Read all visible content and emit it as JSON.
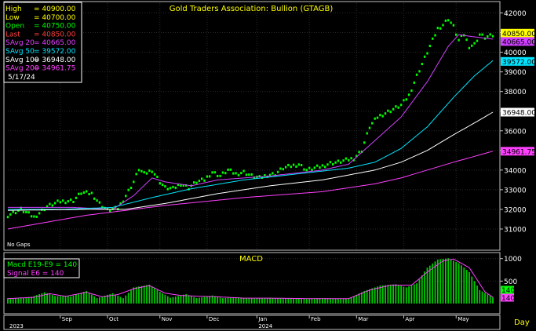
{
  "chart_data": [
    {
      "type": "scatter",
      "title": "Gold Traders Association: Bullion (GTAGB)",
      "ylim": [
        30000,
        42500
      ],
      "y_ticks": [
        31000,
        32000,
        33000,
        34000,
        35000,
        36000,
        37000,
        38000,
        39000,
        40000,
        41000,
        42000
      ],
      "footnote": "No Gaps",
      "info_box": {
        "rows": [
          {
            "label": "High",
            "value": "40900.00",
            "color": "#ffff00"
          },
          {
            "label": "Low",
            "value": "40700.00",
            "color": "#ffff00"
          },
          {
            "label": "Open",
            "value": "40750.00",
            "color": "#00ff00"
          },
          {
            "label": "Last",
            "value": "40850.00",
            "color": "#ff4040"
          },
          {
            "label": "SAvg  20",
            "value": "40665.00",
            "color": "#e040ff"
          },
          {
            "label": "SAvg  50",
            "value": "39572.00",
            "color": "#00e5ff"
          },
          {
            "label": "SAvg 100",
            "value": "36948.00",
            "color": "#ffffff"
          },
          {
            "label": "SAvg 200",
            "value": "34961.75",
            "color": "#ff40ff"
          }
        ],
        "date": "5/17/24"
      },
      "price_series": {
        "name": "Last",
        "color": "#00ff00",
        "anchors": [
          [
            0,
            31700
          ],
          [
            5,
            32000
          ],
          [
            10,
            31600
          ],
          [
            15,
            32150
          ],
          [
            20,
            32400
          ],
          [
            25,
            32450
          ],
          [
            28,
            32850
          ],
          [
            32,
            32800
          ],
          [
            35,
            32300
          ],
          [
            38,
            31950
          ],
          [
            42,
            32050
          ],
          [
            45,
            32700
          ],
          [
            48,
            33400
          ],
          [
            50,
            34050
          ],
          [
            52,
            33800
          ],
          [
            55,
            34000
          ],
          [
            58,
            33400
          ],
          [
            60,
            33100
          ],
          [
            63,
            33050
          ],
          [
            66,
            33300
          ],
          [
            69,
            33100
          ],
          [
            72,
            33400
          ],
          [
            75,
            33500
          ],
          [
            78,
            33900
          ],
          [
            81,
            33700
          ],
          [
            84,
            34000
          ],
          [
            87,
            33800
          ],
          [
            90,
            33900
          ],
          [
            93,
            33700
          ],
          [
            96,
            33600
          ],
          [
            99,
            33750
          ],
          [
            102,
            33800
          ],
          [
            105,
            34100
          ],
          [
            108,
            34200
          ],
          [
            111,
            34300
          ],
          [
            114,
            34000
          ],
          [
            117,
            34100
          ],
          [
            120,
            34200
          ],
          [
            123,
            34350
          ],
          [
            126,
            34400
          ],
          [
            129,
            34500
          ],
          [
            132,
            34600
          ],
          [
            135,
            35000
          ],
          [
            138,
            36200
          ],
          [
            141,
            36700
          ],
          [
            144,
            36900
          ],
          [
            147,
            37100
          ],
          [
            150,
            37300
          ],
          [
            153,
            37800
          ],
          [
            156,
            38800
          ],
          [
            159,
            39700
          ],
          [
            162,
            40600
          ],
          [
            164,
            41200
          ],
          [
            166,
            41400
          ],
          [
            168,
            41700
          ],
          [
            170,
            41300
          ],
          [
            172,
            40600
          ],
          [
            174,
            40900
          ],
          [
            176,
            40300
          ],
          [
            178,
            40400
          ],
          [
            180,
            40900
          ],
          [
            182,
            40750
          ],
          [
            185,
            40850
          ]
        ]
      },
      "averages": [
        {
          "name": "SAvg 20",
          "color": "#d040ff",
          "value": "40665.00",
          "anchors": [
            [
              0,
              32100
            ],
            [
              25,
              32100
            ],
            [
              40,
              32000
            ],
            [
              48,
              32700
            ],
            [
              55,
              33600
            ],
            [
              60,
              33400
            ],
            [
              70,
              33200
            ],
            [
              80,
              33500
            ],
            [
              100,
              33700
            ],
            [
              120,
              34000
            ],
            [
              130,
              34300
            ],
            [
              140,
              35500
            ],
            [
              150,
              36700
            ],
            [
              160,
              38500
            ],
            [
              168,
              40300
            ],
            [
              172,
              40900
            ],
            [
              177,
              40800
            ],
            [
              185,
              40665
            ]
          ]
        },
        {
          "name": "SAvg 50",
          "color": "#00e5ff",
          "value": "39572.00",
          "anchors": [
            [
              0,
              32000
            ],
            [
              20,
              32000
            ],
            [
              40,
              32100
            ],
            [
              55,
              32600
            ],
            [
              70,
              33050
            ],
            [
              90,
              33500
            ],
            [
              110,
              33800
            ],
            [
              130,
              34100
            ],
            [
              140,
              34400
            ],
            [
              150,
              35100
            ],
            [
              160,
              36200
            ],
            [
              170,
              37700
            ],
            [
              178,
              38800
            ],
            [
              185,
              39572
            ]
          ]
        },
        {
          "name": "SAvg 100",
          "color": "#ffffff",
          "value": "36948.00",
          "anchors": [
            [
              0,
              31950
            ],
            [
              30,
              32000
            ],
            [
              45,
              32000
            ],
            [
              60,
              32300
            ],
            [
              80,
              32800
            ],
            [
              100,
              33200
            ],
            [
              120,
              33500
            ],
            [
              140,
              34000
            ],
            [
              150,
              34400
            ],
            [
              160,
              35000
            ],
            [
              170,
              35800
            ],
            [
              178,
              36400
            ],
            [
              185,
              36948
            ]
          ]
        },
        {
          "name": "SAvg 200",
          "color": "#ff40ff",
          "value": "34961.75",
          "anchors": [
            [
              0,
              31000
            ],
            [
              30,
              31700
            ],
            [
              60,
              32200
            ],
            [
              90,
              32600
            ],
            [
              120,
              32900
            ],
            [
              140,
              33300
            ],
            [
              150,
              33600
            ],
            [
              160,
              34000
            ],
            [
              170,
              34400
            ],
            [
              178,
              34700
            ],
            [
              185,
              34961.75
            ]
          ]
        }
      ],
      "right_labels": [
        {
          "value": "40850.00",
          "bg": "#ffff00"
        },
        {
          "value": "40665.00",
          "bg": "#d040ff"
        },
        {
          "value": "39572.00",
          "bg": "#00e5ff"
        },
        {
          "value": "36948.00",
          "bg": "#ffffff"
        },
        {
          "value": "34961.75",
          "bg": "#ff40ff"
        }
      ]
    },
    {
      "type": "bar",
      "title": "MACD",
      "ylim": [
        0,
        1100
      ],
      "y_ticks": [
        500,
        1000
      ],
      "legend": [
        {
          "label": "Macd  E19-E9",
          "value": "140",
          "color": "#00ff00"
        },
        {
          "label": "Signal  E6",
          "value": "140",
          "color": "#ff40ff"
        }
      ],
      "histogram_anchors": [
        [
          0,
          120
        ],
        [
          8,
          130
        ],
        [
          14,
          250
        ],
        [
          18,
          170
        ],
        [
          24,
          160
        ],
        [
          30,
          280
        ],
        [
          34,
          120
        ],
        [
          40,
          230
        ],
        [
          44,
          120
        ],
        [
          48,
          360
        ],
        [
          54,
          420
        ],
        [
          58,
          260
        ],
        [
          62,
          130
        ],
        [
          68,
          210
        ],
        [
          72,
          120
        ],
        [
          78,
          180
        ],
        [
          82,
          120
        ],
        [
          88,
          140
        ],
        [
          94,
          110
        ],
        [
          100,
          130
        ],
        [
          110,
          110
        ],
        [
          120,
          120
        ],
        [
          130,
          110
        ],
        [
          136,
          280
        ],
        [
          142,
          400
        ],
        [
          148,
          430
        ],
        [
          152,
          360
        ],
        [
          156,
          450
        ],
        [
          160,
          800
        ],
        [
          164,
          980
        ],
        [
          168,
          1010
        ],
        [
          172,
          900
        ],
        [
          176,
          700
        ],
        [
          180,
          300
        ],
        [
          185,
          140
        ]
      ],
      "signal_anchors": [
        [
          0,
          110
        ],
        [
          10,
          140
        ],
        [
          16,
          220
        ],
        [
          22,
          160
        ],
        [
          30,
          250
        ],
        [
          36,
          150
        ],
        [
          42,
          200
        ],
        [
          48,
          330
        ],
        [
          54,
          400
        ],
        [
          60,
          230
        ],
        [
          66,
          180
        ],
        [
          74,
          160
        ],
        [
          80,
          150
        ],
        [
          90,
          120
        ],
        [
          100,
          120
        ],
        [
          115,
          110
        ],
        [
          130,
          110
        ],
        [
          138,
          300
        ],
        [
          146,
          410
        ],
        [
          154,
          410
        ],
        [
          160,
          700
        ],
        [
          166,
          950
        ],
        [
          170,
          990
        ],
        [
          176,
          800
        ],
        [
          182,
          260
        ],
        [
          185,
          140
        ]
      ],
      "right_labels": [
        {
          "value": "140",
          "bg": "#00ff00"
        },
        {
          "value": "140",
          "bg": "#ff40ff"
        }
      ]
    }
  ],
  "x_axis": {
    "n": 186,
    "top_labels": [
      {
        "i": 20,
        "text": "Sep"
      },
      {
        "i": 38,
        "text": "Oct"
      },
      {
        "i": 58,
        "text": "Nov"
      },
      {
        "i": 76,
        "text": "Dec"
      },
      {
        "i": 95,
        "text": "Jan"
      },
      {
        "i": 115,
        "text": "Feb"
      },
      {
        "i": 133,
        "text": "Mar"
      },
      {
        "i": 151,
        "text": "Apr"
      },
      {
        "i": 171,
        "text": "May"
      }
    ],
    "bottom_labels": [
      {
        "i": 0,
        "text": "2023"
      },
      {
        "i": 95,
        "text": "2024"
      }
    ],
    "unit": "Day"
  }
}
